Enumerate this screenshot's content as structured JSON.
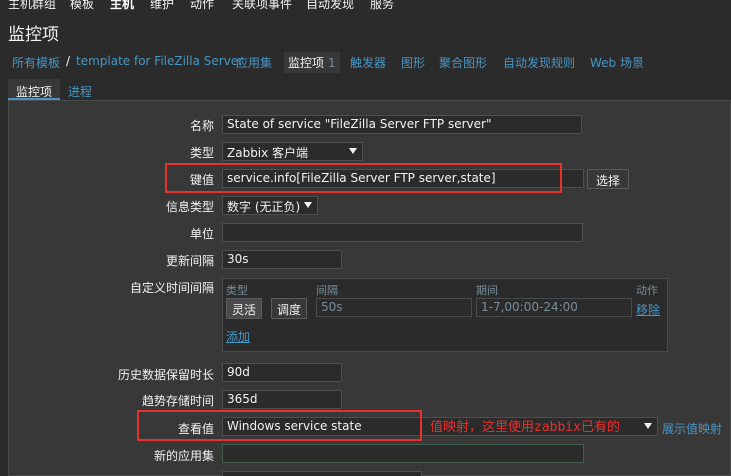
{
  "top_nav": [
    "主机群组",
    "模板",
    "主机",
    "维护",
    "动作",
    "关联项事件",
    "自动发现",
    "服务"
  ],
  "page_title": "监控项",
  "breadcrumbs": {
    "all_templates": "所有模板",
    "separator": "/",
    "template": "template for FileZilla Server",
    "applications": "应用集",
    "items": "监控项",
    "items_count": "1",
    "triggers": "触发器",
    "graphs": "图形",
    "screens": "聚合图形",
    "discovery_rules": "自动发现规则",
    "web_scenarios": "Web 场景"
  },
  "form_tabs": {
    "item": "监控项",
    "process": "进程"
  },
  "form": {
    "name_label": "名称",
    "name_value": "State of service \"FileZilla Server FTP server\"",
    "type_label": "类型",
    "type_value": "Zabbix 客户端",
    "key_label": "键值",
    "key_value": "service.info[FileZilla Server FTP server,state]",
    "select_button": "选择",
    "info_type_label": "信息类型",
    "info_type_value": "数字 (无正负)",
    "units_label": "单位",
    "units_value": "",
    "update_interval_label": "更新间隔",
    "update_interval_value": "30s",
    "custom_intervals_label": "自定义时间间隔",
    "custom_intervals": {
      "col_type": "类型",
      "col_interval": "间隔",
      "col_period": "期间",
      "col_action": "动作",
      "flexible": "灵活",
      "scheduling": "调度",
      "interval_value": "50s",
      "period_value": "1-7,00:00-24:00",
      "remove": "移除",
      "add": "添加"
    },
    "history_label": "历史数据保留时长",
    "history_value": "90d",
    "trends_label": "趋势存储时间",
    "trends_value": "365d",
    "show_value_label": "查看值",
    "show_value_value": "Windows service state",
    "show_value_mappings_link": "展示值映射",
    "new_application_label": "新的应用集",
    "new_application_value": ""
  },
  "annotation_text": "值映射，这里使用zabbix已有的",
  "colors": {
    "highlight": "#e8302c",
    "link": "#4796c4",
    "background": "#2b2b2b",
    "panel": "#383838"
  }
}
